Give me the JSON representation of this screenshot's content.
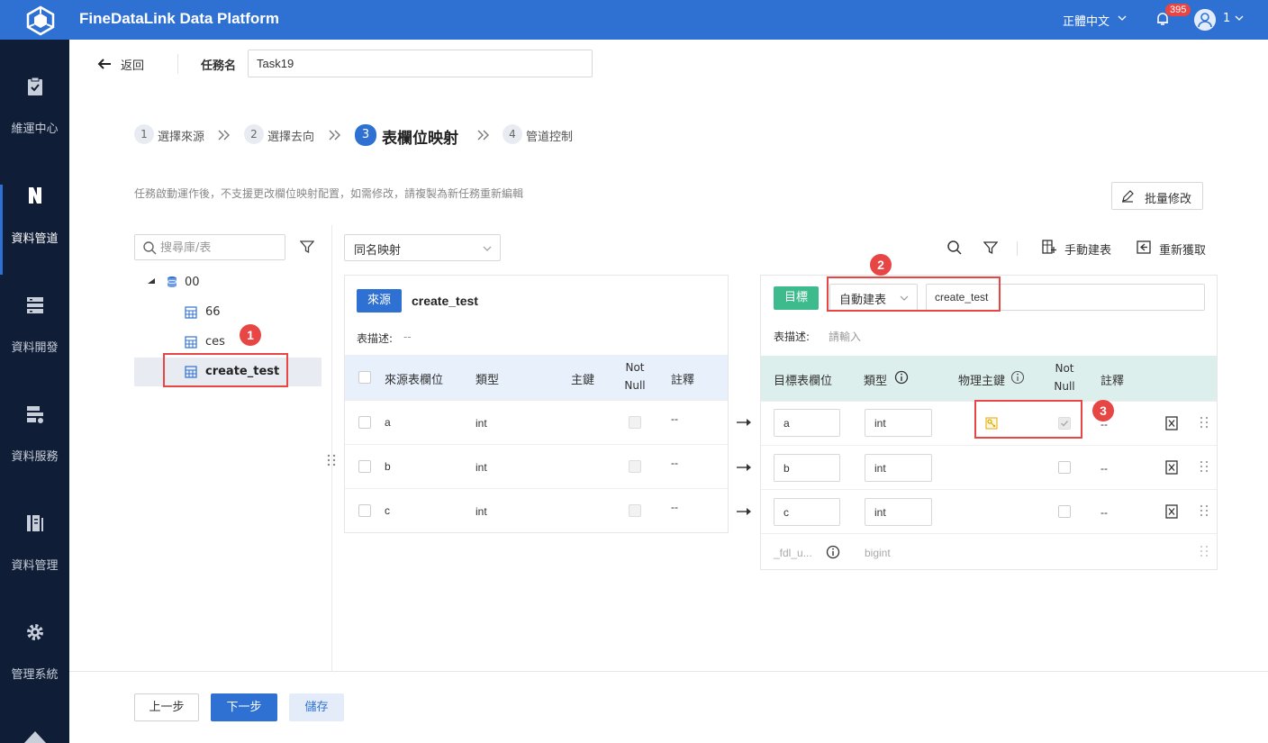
{
  "app": {
    "title": "FineDataLink Data Platform",
    "language": "正體中文",
    "notification_count": "395",
    "user_name": "1"
  },
  "colors": {
    "brand": "#2f71d2",
    "sidebar_bg": "#101d36",
    "highlight": "#e84545",
    "source_tag": "#2f71d2",
    "target_tag": "#3dbb8c"
  },
  "sidebar": {
    "items": [
      {
        "label": "維運中心",
        "icon": "clipboard-check-icon"
      },
      {
        "label": "資料管道",
        "icon": "pipeline-icon",
        "active": true
      },
      {
        "label": "資料開發",
        "icon": "dev-stack-icon"
      },
      {
        "label": "資料服務",
        "icon": "service-icon"
      },
      {
        "label": "資料管理",
        "icon": "data-manage-icon"
      },
      {
        "label": "管理系統",
        "icon": "gear-icon"
      }
    ]
  },
  "header": {
    "back_label": "返回",
    "task_name_label": "任務名",
    "task_name_value": "Task19"
  },
  "steps": [
    {
      "num": "1",
      "label": "選擇來源"
    },
    {
      "num": "2",
      "label": "選擇去向"
    },
    {
      "num": "3",
      "label": "表欄位映射",
      "active": true
    },
    {
      "num": "4",
      "label": "管道控制"
    }
  ],
  "hint": "任務啟動運作後，不支援更改欄位映射配置，如需修改，請複製為新任務重新編輯",
  "batch_edit_label": "批量修改",
  "tree": {
    "search_placeholder": "搜尋庫/表",
    "db": "00",
    "tables": [
      "66",
      "ces",
      "create_test"
    ],
    "selected": "create_test"
  },
  "mapping": {
    "mode": "同名映射",
    "tools": {
      "manual_create": "手動建表",
      "refresh": "重新獲取"
    }
  },
  "source": {
    "tag": "來源",
    "table": "create_test",
    "desc_label": "表描述:",
    "desc_value": "--",
    "columns": {
      "field": "來源表欄位",
      "type": "類型",
      "pk": "主鍵",
      "notnull_1": "Not",
      "notnull_2": "Null",
      "comment": "註釋"
    },
    "rows": [
      {
        "field": "a",
        "type": "int",
        "comment": "--"
      },
      {
        "field": "b",
        "type": "int",
        "comment": "--"
      },
      {
        "field": "c",
        "type": "int",
        "comment": "--"
      }
    ]
  },
  "target": {
    "tag": "目標",
    "create_mode": "自動建表",
    "table": "create_test",
    "desc_label": "表描述:",
    "desc_placeholder": "請輸入",
    "columns": {
      "field": "目標表欄位",
      "type": "類型",
      "physical_pk": "物理主鍵",
      "notnull_1": "Not",
      "notnull_2": "Null",
      "comment": "註釋"
    },
    "rows": [
      {
        "field": "a",
        "type": "int",
        "comment": "--",
        "pk": true,
        "notnull": true
      },
      {
        "field": "b",
        "type": "int",
        "comment": "--",
        "pk": false,
        "notnull": false
      },
      {
        "field": "c",
        "type": "int",
        "comment": "--",
        "pk": false,
        "notnull": false
      }
    ],
    "system_row": {
      "field": "_fdl_u...",
      "type": "bigint"
    }
  },
  "callouts": [
    "1",
    "2",
    "3"
  ],
  "footer": {
    "prev": "上一步",
    "next": "下一步",
    "save": "儲存"
  }
}
